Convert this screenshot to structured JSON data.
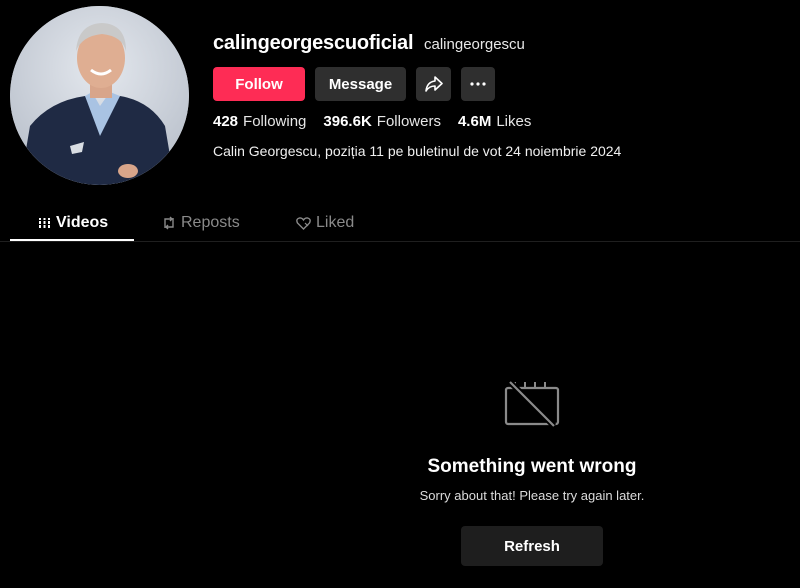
{
  "profile": {
    "username": "calingeorgescuoficial",
    "nickname": "calingeorgescu",
    "bio": "Calin Georgescu, poziția 11 pe buletinul de vot 24 noiembrie 2024",
    "avatar_icon": "profile-photo"
  },
  "actions": {
    "follow_label": "Follow",
    "message_label": "Message",
    "share_icon": "share-arrow-icon",
    "more_icon": "more-dots-icon"
  },
  "stats": {
    "following": {
      "value": "428",
      "label": "Following"
    },
    "followers": {
      "value": "396.6K",
      "label": "Followers"
    },
    "likes": {
      "value": "4.6M",
      "label": "Likes"
    }
  },
  "tabs": [
    {
      "label": "Videos",
      "icon": "grid-icon",
      "active": true
    },
    {
      "label": "Reposts",
      "icon": "repost-icon",
      "active": false
    },
    {
      "label": "Liked",
      "icon": "heart-icon",
      "active": false
    }
  ],
  "error": {
    "icon": "no-video-icon",
    "title": "Something went wrong",
    "subtitle": "Sorry about that! Please try again later.",
    "refresh_label": "Refresh"
  },
  "colors": {
    "background": "#000000",
    "accent": "#fe2c55",
    "button_secondary": "#2f2f2f"
  }
}
